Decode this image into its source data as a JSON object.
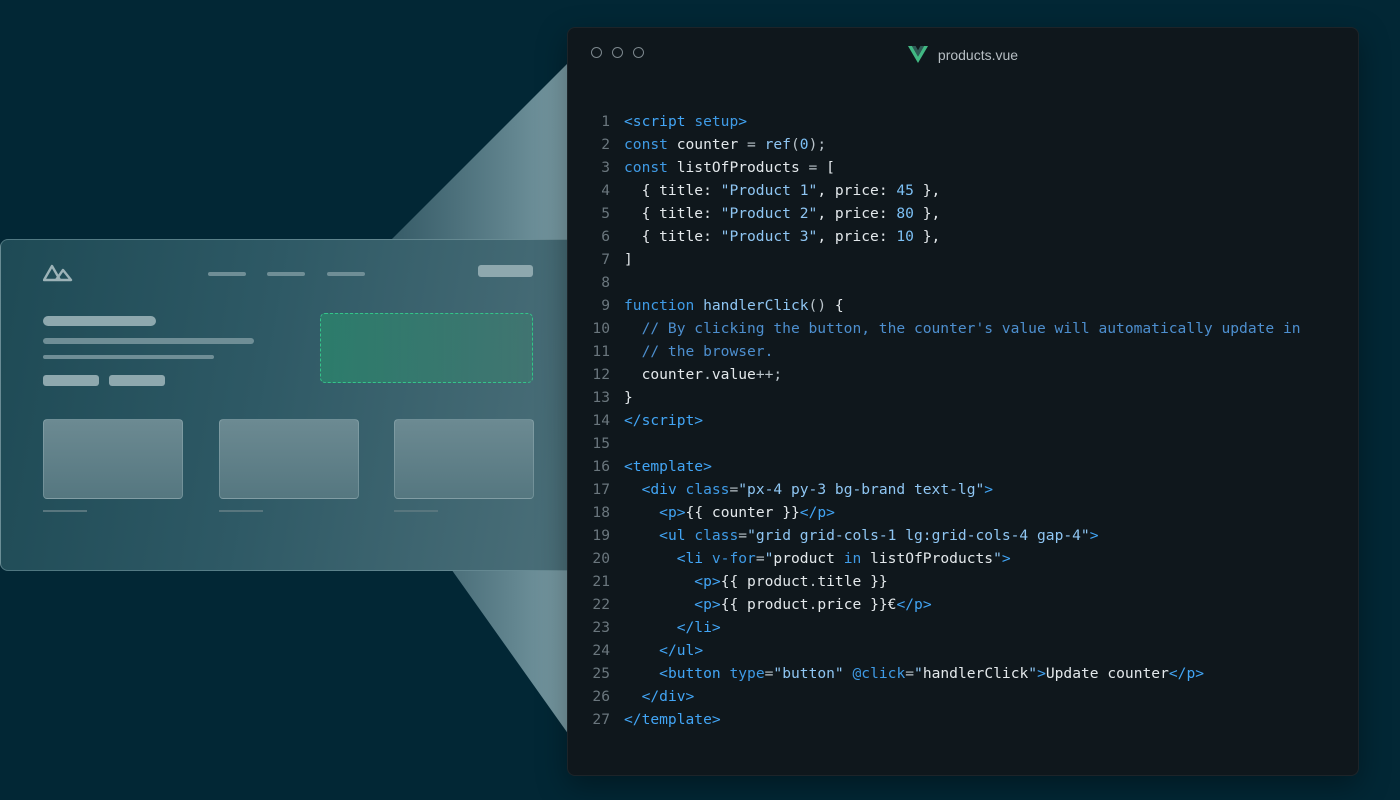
{
  "editor": {
    "filename": "products.vue"
  },
  "code_lines": [
    [
      [
        "tg",
        "<"
      ],
      [
        "tg",
        "script"
      ],
      [
        "tx",
        " "
      ],
      [
        "an",
        "setup"
      ],
      [
        "tg",
        ">"
      ]
    ],
    [
      [
        "kw",
        "const"
      ],
      [
        "tx",
        " counter "
      ],
      [
        "pn",
        "="
      ],
      [
        "tx",
        " "
      ],
      [
        "fn",
        "ref"
      ],
      [
        "pn",
        "("
      ],
      [
        "nm",
        "0"
      ],
      [
        "pn",
        ");"
      ]
    ],
    [
      [
        "kw",
        "const"
      ],
      [
        "tx",
        " listOfProducts "
      ],
      [
        "pn",
        "="
      ],
      [
        "tx",
        " ["
      ]
    ],
    [
      [
        "tx",
        "  { title: "
      ],
      [
        "st",
        "\"Product 1\""
      ],
      [
        "tx",
        ", price: "
      ],
      [
        "nm",
        "45"
      ],
      [
        "tx",
        " },"
      ]
    ],
    [
      [
        "tx",
        "  { title: "
      ],
      [
        "st",
        "\"Product 2\""
      ],
      [
        "tx",
        ", price: "
      ],
      [
        "nm",
        "80"
      ],
      [
        "tx",
        " },"
      ]
    ],
    [
      [
        "tx",
        "  { title: "
      ],
      [
        "st",
        "\"Product 3\""
      ],
      [
        "tx",
        ", price: "
      ],
      [
        "nm",
        "10"
      ],
      [
        "tx",
        " },"
      ]
    ],
    [
      [
        "tx",
        "]"
      ]
    ],
    [],
    [
      [
        "kw",
        "function"
      ],
      [
        "tx",
        " "
      ],
      [
        "fn",
        "handlerClick"
      ],
      [
        "pn",
        "()"
      ],
      [
        "tx",
        " {"
      ]
    ],
    [
      [
        "tx",
        "  "
      ],
      [
        "cm",
        "// By clicking the button, the counter's value will automatically update in"
      ]
    ],
    [
      [
        "tx",
        "  "
      ],
      [
        "cm",
        "// the browser."
      ]
    ],
    [
      [
        "tx",
        "  counter"
      ],
      [
        "pn",
        "."
      ],
      [
        "tx",
        "value"
      ],
      [
        "pn",
        "++;"
      ]
    ],
    [
      [
        "tx",
        "}"
      ]
    ],
    [
      [
        "tg",
        "</"
      ],
      [
        "tg",
        "script"
      ],
      [
        "tg",
        ">"
      ]
    ],
    [],
    [
      [
        "tg",
        "<"
      ],
      [
        "tg",
        "template"
      ],
      [
        "tg",
        ">"
      ]
    ],
    [
      [
        "tx",
        "  "
      ],
      [
        "tg",
        "<"
      ],
      [
        "tg",
        "div"
      ],
      [
        "tx",
        " "
      ],
      [
        "an",
        "class"
      ],
      [
        "pn",
        "="
      ],
      [
        "st",
        "\"px-4 py-3 bg-brand text-lg\""
      ],
      [
        "tg",
        ">"
      ]
    ],
    [
      [
        "tx",
        "    "
      ],
      [
        "tg",
        "<"
      ],
      [
        "tg",
        "p"
      ],
      [
        "tg",
        ">"
      ],
      [
        "tx",
        "{{ counter }}"
      ],
      [
        "tg",
        "</"
      ],
      [
        "tg",
        "p"
      ],
      [
        "tg",
        ">"
      ]
    ],
    [
      [
        "tx",
        "    "
      ],
      [
        "tg",
        "<"
      ],
      [
        "tg",
        "ul"
      ],
      [
        "tx",
        " "
      ],
      [
        "an",
        "class"
      ],
      [
        "pn",
        "="
      ],
      [
        "st",
        "\"grid grid-cols-1 lg:grid-cols-4 gap-4\""
      ],
      [
        "tg",
        ">"
      ]
    ],
    [
      [
        "tx",
        "      "
      ],
      [
        "tg",
        "<"
      ],
      [
        "tg",
        "li"
      ],
      [
        "tx",
        " "
      ],
      [
        "an",
        "v-for"
      ],
      [
        "pn",
        "="
      ],
      [
        "st",
        "\""
      ],
      [
        "tx",
        "product "
      ],
      [
        "an",
        "in"
      ],
      [
        "tx",
        " listOfProducts"
      ],
      [
        "st",
        "\""
      ],
      [
        "tg",
        ">"
      ]
    ],
    [
      [
        "tx",
        "        "
      ],
      [
        "tg",
        "<"
      ],
      [
        "tg",
        "p"
      ],
      [
        "tg",
        ">"
      ],
      [
        "tx",
        "{{ product"
      ],
      [
        "pn",
        "."
      ],
      [
        "tx",
        "title }}"
      ]
    ],
    [
      [
        "tx",
        "        "
      ],
      [
        "tg",
        "<"
      ],
      [
        "tg",
        "p"
      ],
      [
        "tg",
        ">"
      ],
      [
        "tx",
        "{{ product"
      ],
      [
        "pn",
        "."
      ],
      [
        "tx",
        "price }}€"
      ],
      [
        "tg",
        "</"
      ],
      [
        "tg",
        "p"
      ],
      [
        "tg",
        ">"
      ]
    ],
    [
      [
        "tx",
        "      "
      ],
      [
        "tg",
        "</"
      ],
      [
        "tg",
        "li"
      ],
      [
        "tg",
        ">"
      ]
    ],
    [
      [
        "tx",
        "    "
      ],
      [
        "tg",
        "</"
      ],
      [
        "tg",
        "ul"
      ],
      [
        "tg",
        ">"
      ]
    ],
    [
      [
        "tx",
        "    "
      ],
      [
        "tg",
        "<"
      ],
      [
        "tg",
        "button"
      ],
      [
        "tx",
        " "
      ],
      [
        "an",
        "type"
      ],
      [
        "pn",
        "="
      ],
      [
        "st",
        "\"button\""
      ],
      [
        "tx",
        " "
      ],
      [
        "an",
        "@click"
      ],
      [
        "pn",
        "="
      ],
      [
        "st",
        "\""
      ],
      [
        "tx",
        "handlerClick"
      ],
      [
        "st",
        "\""
      ],
      [
        "tg",
        ">"
      ],
      [
        "tx",
        "Update counter"
      ],
      [
        "tg",
        "</"
      ],
      [
        "tg",
        "p"
      ],
      [
        "tg",
        ">"
      ]
    ],
    [
      [
        "tx",
        "  "
      ],
      [
        "tg",
        "</"
      ],
      [
        "tg",
        "div"
      ],
      [
        "tg",
        ">"
      ]
    ],
    [
      [
        "tg",
        "</"
      ],
      [
        "tg",
        "template"
      ],
      [
        "tg",
        ">"
      ]
    ]
  ]
}
